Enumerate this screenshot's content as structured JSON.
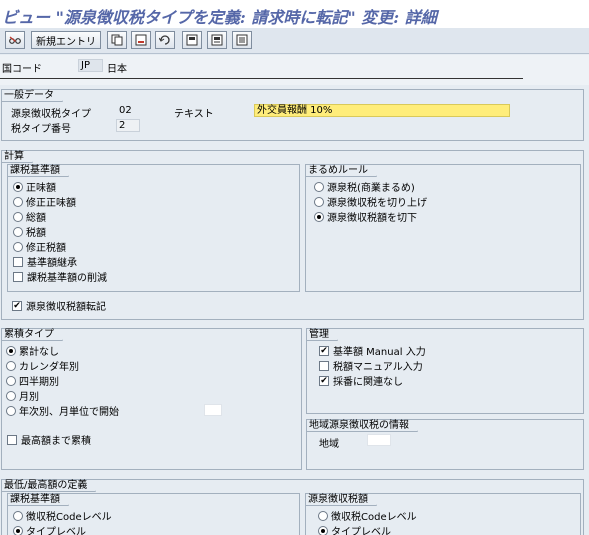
{
  "window": {
    "title": "ビュー \"源泉徴収税タイプを定義: 請求時に転記\" 変更: 詳細"
  },
  "toolbar": {
    "new_entries_label": "新規エントリ"
  },
  "header": {
    "country_label": "国コード",
    "country_code": "JP",
    "country_name": "日本"
  },
  "general": {
    "title": "一般データ",
    "wht_type_label": "源泉徴収税タイプ",
    "wht_type_value": "02",
    "text_label": "テキスト",
    "text_value": "外交員報酬 10%",
    "tax_type_no_label": "税タイプ番号",
    "tax_type_no_value": "2"
  },
  "calc": {
    "title": "計算",
    "base": {
      "title": "課税基準額",
      "options": [
        "正味額",
        "修正正味額",
        "総額",
        "税額",
        "修正税額"
      ],
      "selected": 0,
      "checks": [
        {
          "label": "基準額継承",
          "checked": false
        },
        {
          "label": "課税基準額の削減",
          "checked": false
        }
      ]
    },
    "rounding": {
      "title": "まるめルール",
      "options": [
        "源泉税(商業まるめ)",
        "源泉徴収税を切り上げ",
        "源泉徴収税額を切下"
      ],
      "selected": 2
    },
    "post_check": {
      "label": "源泉徴収税額転記",
      "checked": true
    }
  },
  "accum": {
    "title": "累積タイプ",
    "options": [
      "累計なし",
      "カレンダ年別",
      "四半期別",
      "月別",
      "年次別、月単位で開始"
    ],
    "selected": 0,
    "max_check": {
      "label": "最高額まで累積",
      "checked": false
    }
  },
  "control": {
    "title": "管理",
    "checks": [
      {
        "label": "基準額 Manual 入力",
        "checked": true
      },
      {
        "label": "税額マニュアル入力",
        "checked": false
      },
      {
        "label": "採番に関連なし",
        "checked": true
      }
    ]
  },
  "regional": {
    "title": "地域源泉徴収税の情報",
    "region_label": "地域"
  },
  "minmax": {
    "title": "最低/最高額の定義",
    "base": {
      "title": "課税基準額",
      "options": [
        "徴収税Codeレベル",
        "タイプレベル"
      ],
      "selected": 1
    },
    "wht": {
      "title": "源泉徴収税額",
      "options": [
        "徴収税Codeレベル",
        "タイプレベル"
      ],
      "selected": 1
    }
  },
  "check_mark": "✔"
}
